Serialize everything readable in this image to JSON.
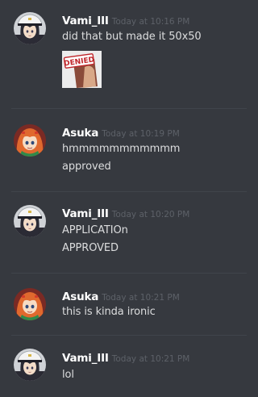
{
  "messages": [
    {
      "username": "Vami_III",
      "timestamp": "Today at 10:16 PM",
      "lines": [
        "did that but made it 50x50"
      ],
      "attachment": {
        "stamp_text": "DENIED"
      }
    },
    {
      "username": "Asuka",
      "timestamp": "Today at 10:19 PM",
      "lines": [
        "hmmmmmmmmmmm",
        "approved"
      ]
    },
    {
      "username": "Vami_III",
      "timestamp": "Today at 10:20 PM",
      "lines": [
        "APPLICATIOn",
        "APPROVED"
      ]
    },
    {
      "username": "Asuka",
      "timestamp": "Today at 10:21 PM",
      "lines": [
        "this is kinda ironic"
      ]
    },
    {
      "username": "Vami_III",
      "timestamp": "Today at 10:21 PM",
      "lines": [
        "lol"
      ]
    }
  ],
  "colors": {
    "background": "#36393f",
    "username": "#ffffff",
    "timestamp": "#5d6168",
    "message_text": "#dcddde",
    "divider": "#40444b"
  },
  "icons": {
    "vami_avatar": "white-cap-anime-avatar",
    "asuka_avatar": "orange-hair-anime-avatar",
    "attachment": "denied-stamp-image"
  }
}
